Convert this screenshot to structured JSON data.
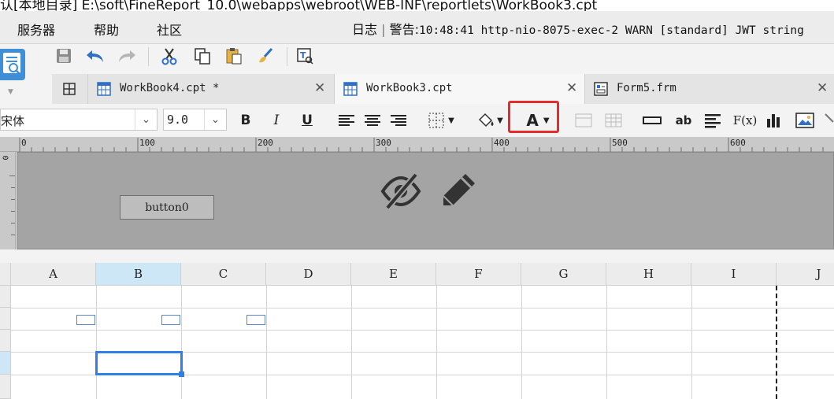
{
  "window": {
    "title": "认[本地目录]   E:\\soft\\FineReport_10.0\\webapps\\webroot\\WEB-INF\\reportlets\\WorkBook3.cpt"
  },
  "menubar": {
    "items": [
      "服务器",
      "帮助",
      "社区"
    ],
    "log_label": "日志",
    "warning_label": "警告:",
    "warning_text": "10:48:41 http-nio-8075-exec-2 WARN [standard] JWT string"
  },
  "quick_toolbar": {
    "icons": [
      "save-icon",
      "undo-icon",
      "redo-icon",
      "cut-icon",
      "copy-icon",
      "paste-icon",
      "format-painter-icon",
      "template-param-icon"
    ]
  },
  "tabs": [
    {
      "label": "WorkBook4.cpt *",
      "icon": "workbook-icon",
      "active": false
    },
    {
      "label": "WorkBook3.cpt",
      "icon": "workbook-icon",
      "active": true
    },
    {
      "label": "Form5.frm",
      "icon": "form-icon",
      "active": false
    }
  ],
  "format_toolbar": {
    "font_name": "宋体",
    "font_size": "9.0",
    "bold_label": "B",
    "italic_label": "I",
    "underline_label": "U",
    "font_color_label": "A",
    "text_widget_label": "ab",
    "formula_label": "F(x)"
  },
  "ruler": {
    "labels": [
      "0",
      "100",
      "200",
      "300",
      "400",
      "500",
      "600"
    ],
    "vertical_label": "0"
  },
  "canvas": {
    "button_label": "button0"
  },
  "sheet": {
    "columns": [
      "A",
      "B",
      "C",
      "D",
      "E",
      "F",
      "G",
      "H",
      "I",
      "J"
    ],
    "selected_column": "B"
  },
  "colors": {
    "highlight": "#e52b2b",
    "selection": "#2f7fe8",
    "canvas": "#a4a4a4"
  }
}
